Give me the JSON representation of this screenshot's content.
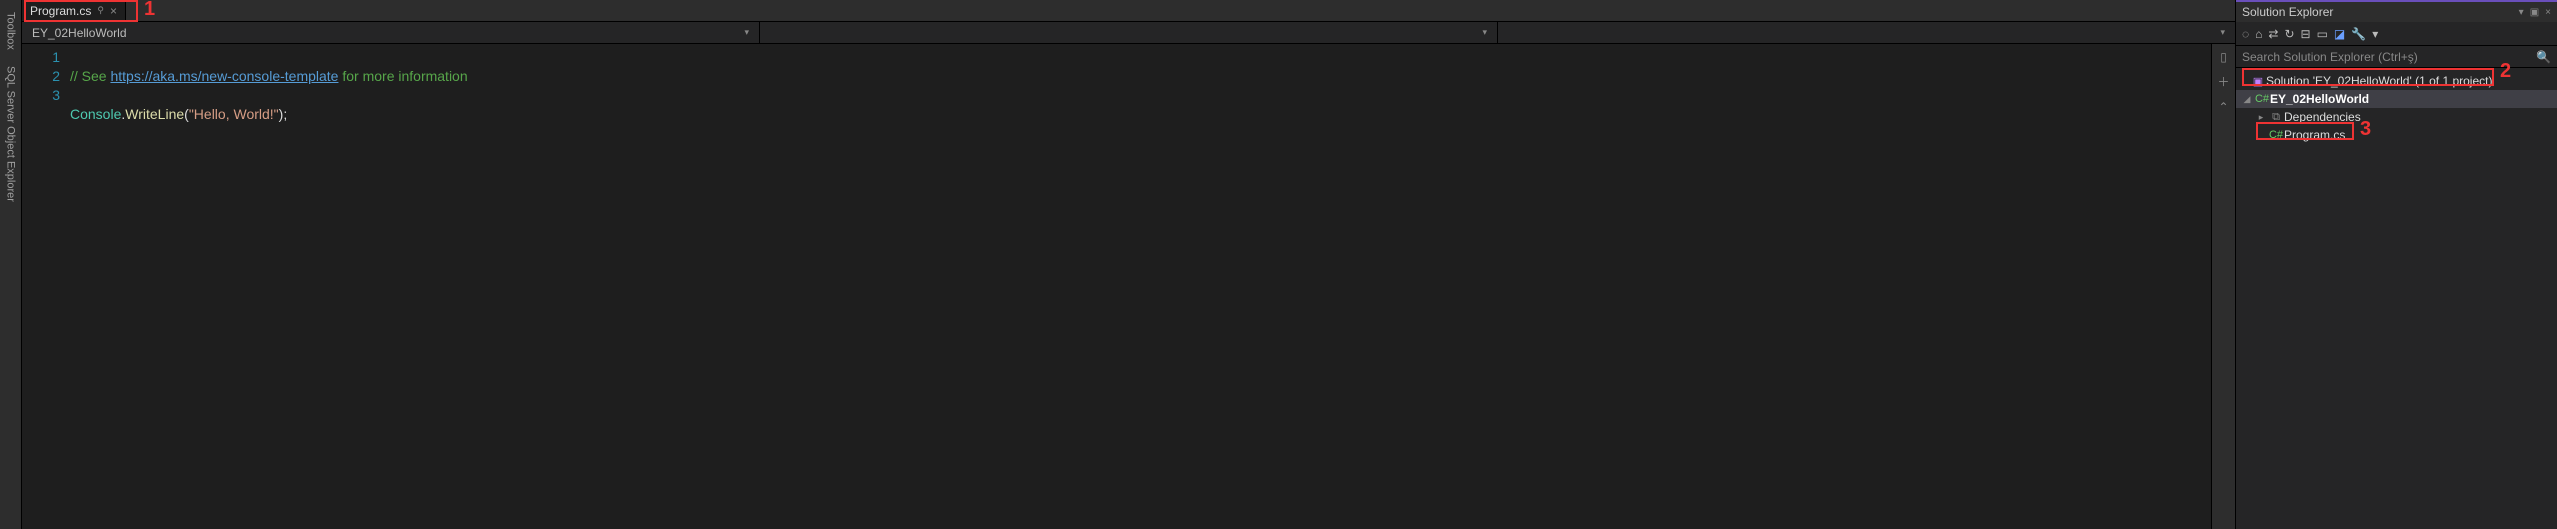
{
  "rail": {
    "toolbox": "Toolbox",
    "sql": "SQL Server Object Explorer"
  },
  "tab": {
    "name": "Program.cs"
  },
  "navbar": {
    "scope": "EY_02HelloWorld"
  },
  "code": {
    "lines": [
      "1",
      "2",
      "3"
    ],
    "l1_pre": "// See ",
    "l1_url": "https://aka.ms/new-console-template",
    "l1_post": " for more information",
    "l2_type": "Console",
    "l2_dot": ".",
    "l2_method": "WriteLine",
    "l2_open": "(",
    "l2_str": "\"Hello, World!\"",
    "l2_close": ");"
  },
  "explorer": {
    "title": "Solution Explorer",
    "search_placeholder": "Search Solution Explorer (Ctrl+ş)",
    "solution": "Solution 'EY_02HelloWorld' (1 of 1 project)",
    "project": "EY_02HelloWorld",
    "deps": "Dependencies",
    "file": "Program.cs"
  },
  "callouts": {
    "n1": "1",
    "n2": "2",
    "n3": "3"
  }
}
